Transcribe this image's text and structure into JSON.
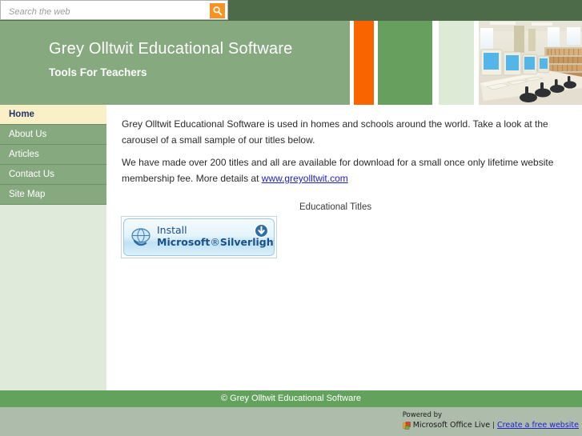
{
  "search": {
    "placeholder": "Search the web",
    "value": "",
    "button_icon": "search-icon"
  },
  "header": {
    "title": "Grey Olltwit Educational Software",
    "subtitle": "Tools For Teachers",
    "photo_alt": "computer-lab-photo",
    "colors": {
      "banner_green": "#87a980",
      "accent_orange": "#fa6400",
      "bar_green": "#67a05e",
      "bar_pale_green": "#dcead6",
      "topbar_dark_green": "#4d6b49"
    }
  },
  "sidebar": {
    "items": [
      {
        "label": "Home",
        "active": true
      },
      {
        "label": "About Us",
        "active": false
      },
      {
        "label": "Articles",
        "active": false
      },
      {
        "label": "Contact Us",
        "active": false
      },
      {
        "label": "Site Map",
        "active": false
      }
    ]
  },
  "main": {
    "paragraph1": "Grey Olltwit Educational Software is used in homes and schools around the world. Take a look at the carousel of a small sample of our titles below.",
    "paragraph2_before_link": "We have made over 200 titles and all are available for download for a small once only lifetime website membership fee. More details at ",
    "link_text": "www.greyolltwit.com",
    "titles_caption": "Educational Titles",
    "silverlight": {
      "line1": "Install",
      "line2_bold": "Microsoft",
      "line2_sup": "®",
      "line2_rest": "Silverlight",
      "line2_tm": "™",
      "download_icon": "download-arrow-icon",
      "globe_icon": "silverlight-globe-icon"
    }
  },
  "footer": {
    "copyright": "© Grey Olltwit Educational Software",
    "powered_by_label": "Powered by",
    "provider_name": "Microsoft Office Live",
    "separator": "|",
    "create_link": "Create a free website",
    "provider_icon": "office-live-icon"
  }
}
